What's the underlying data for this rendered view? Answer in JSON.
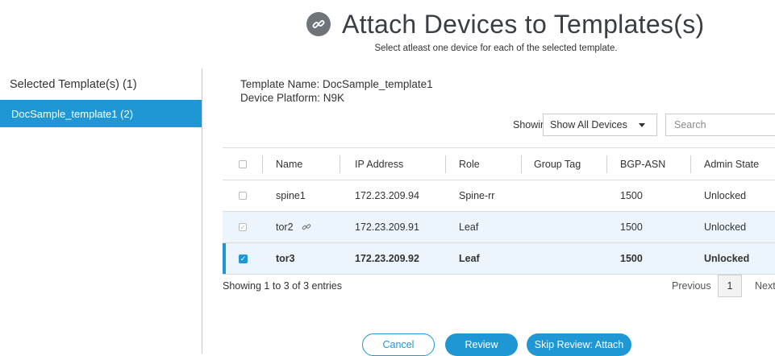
{
  "header": {
    "title": "Attach Devices to Templates(s)",
    "subtitle": "Select atleast one device for each of the selected template.",
    "icon": "link-icon"
  },
  "sidebar": {
    "header": "Selected Template(s) (1)",
    "items": [
      {
        "label": "DocSample_template1 (2)",
        "selected": true
      }
    ]
  },
  "template_info": {
    "name": "Template Name: DocSample_template1",
    "platform": "Device Platform: N9K"
  },
  "filter": {
    "showing_label": "Showing",
    "selected_value": "Show All Devices",
    "search_placeholder": "Search"
  },
  "table": {
    "columns": [
      "Name",
      "IP Address",
      "Role",
      "Group Tag",
      "BGP-ASN",
      "Admin State"
    ],
    "rows": [
      {
        "checked": false,
        "name": "spine1",
        "ip": "172.23.209.94",
        "role": "Spine-rr",
        "group_tag": "",
        "bgp_asn": "1500",
        "admin_state": "Unlocked"
      },
      {
        "checked": true,
        "disabled": true,
        "attached": true,
        "name": "tor2",
        "ip": "172.23.209.91",
        "role": "Leaf",
        "group_tag": "",
        "bgp_asn": "1500",
        "admin_state": "Unlocked"
      },
      {
        "checked": true,
        "name": "tor3",
        "ip": "172.23.209.92",
        "role": "Leaf",
        "group_tag": "",
        "bgp_asn": "1500",
        "admin_state": "Unlocked"
      }
    ]
  },
  "footer": {
    "entries": "Showing 1 to 3 of 3 entries",
    "previous": "Previous",
    "page": "1",
    "next": "Next"
  },
  "actions": {
    "cancel": "Cancel",
    "review": "Review",
    "skip": "Skip Review: Attach"
  },
  "colors": {
    "accent": "#1f97d4",
    "row_highlight": "#ebf5fb"
  }
}
